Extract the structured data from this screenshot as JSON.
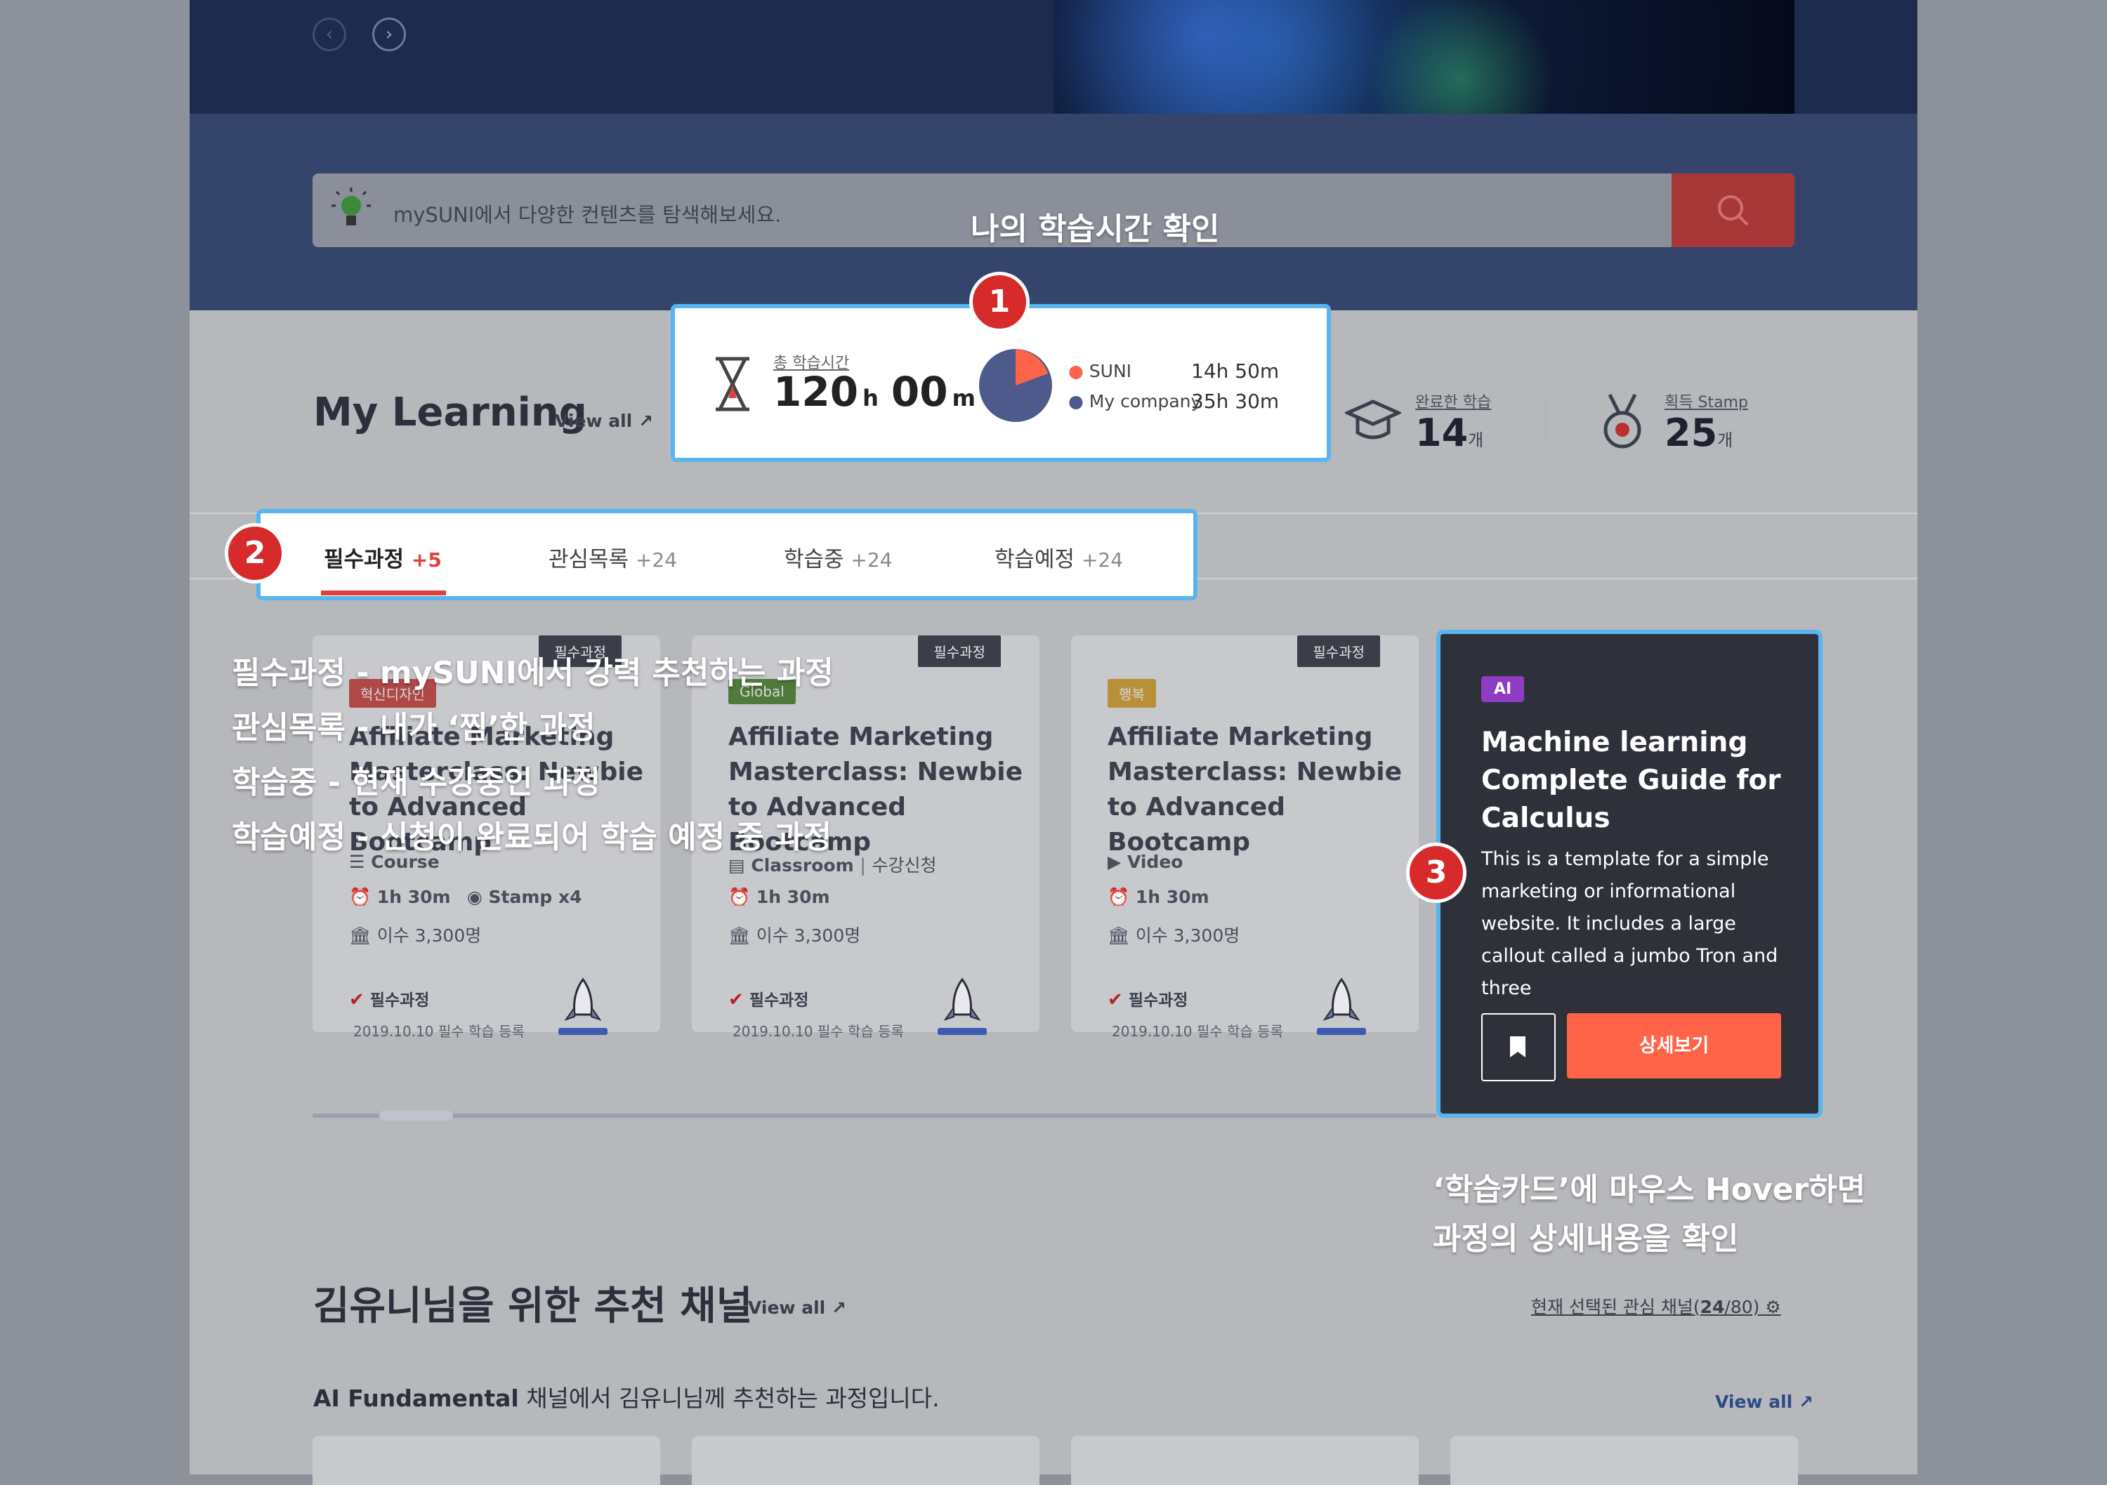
{
  "search": {
    "placeholder": "mySUNI에서 다양한 컨텐츠를 탐색해보세요."
  },
  "hero": {
    "prev_icon": "chevron-left-icon",
    "next_icon": "chevron-right-icon"
  },
  "my_learning": {
    "title": "My Learning",
    "view_all": "View all",
    "total_time": {
      "label": "총 학습시간",
      "hours": "120",
      "hours_unit": "h",
      "minutes": "00",
      "minutes_unit": "m",
      "breakdown": [
        {
          "name": "SUNI",
          "time": "14h 50m",
          "color": "#ff6348"
        },
        {
          "name": "My company",
          "time": "35h 30m",
          "color": "#4e5a8c"
        }
      ]
    },
    "completed": {
      "label": "완료한 학습",
      "value": "14",
      "unit": "개"
    },
    "stamp": {
      "label": "획득 Stamp",
      "value": "25",
      "unit": "개"
    }
  },
  "tabs": [
    {
      "label": "필수과정",
      "count": "+5",
      "active": true
    },
    {
      "label": "관심목록",
      "count": "+24"
    },
    {
      "label": "학습중",
      "count": "+24"
    },
    {
      "label": "학습예정",
      "count": "+24"
    }
  ],
  "cards": [
    {
      "tag": "필수과정",
      "chip": "혁신디자인",
      "chip_color": "#b04848",
      "title": "Affiliate Marketing Masterclass: Newbie to Advanced Bootcamp",
      "type": "Course",
      "duration": "1h 30m",
      "stamp": "Stamp x4",
      "students": "이수 3,300명",
      "required": "필수과정",
      "date": "2019.10.10 필수 학습 등록"
    },
    {
      "tag": "필수과정",
      "chip": "Global",
      "chip_color": "#4f7a3a",
      "title": "Affiliate Marketing Masterclass: Newbie to Advanced Bootcamp",
      "type": "Classroom",
      "type_extra": "수강신청",
      "duration": "1h 30m",
      "students": "이수 3,300명",
      "required": "필수과정",
      "date": "2019.10.10 필수 학습 등록"
    },
    {
      "tag": "필수과정",
      "chip": "행복",
      "chip_color": "#b8903a",
      "title": "Affiliate Marketing Masterclass: Newbie to Advanced Bootcamp",
      "type": "Video",
      "duration": "1h 30m",
      "students": "이수 3,300명",
      "required": "필수과정",
      "date": "2019.10.10 필수 학습 등록"
    }
  ],
  "hover_card": {
    "chip": "AI",
    "title": "Machine learning Complete Guide for Calculus",
    "description": "This is a template for a simple marketing or informational website. It includes a large callout called a jumbo Tron and three",
    "bookmark_icon": "bookmark-icon",
    "detail_button": "상세보기"
  },
  "annotations": {
    "badge1": "1",
    "badge2": "2",
    "badge3": "3",
    "time_note": "나의 학습시간 확인",
    "tab_notes": [
      "필수과정  - mySUNI에서 강력 추천하는 과정",
      "관심목록 - 내가 ‘찜’한 과정",
      "학습중 - 현재 수강중인 과정",
      "학습예정 - 신청이 완료되어 학습 예정 중 과정"
    ],
    "hover_note_1": "‘학습카드’에 마우스 Hover하면",
    "hover_note_2": "과정의 상세내용을 확인"
  },
  "recommend": {
    "title": "김유니님을 위한 추천 채널",
    "view_all": "View all",
    "selected_channels_prefix": "현재 선택된 관심 채널(",
    "selected_channels_value": "24",
    "selected_channels_suffix": "/80)",
    "channel_name": "AI Fundamental",
    "subtitle_rest": " 채널에서 김유니님께 추천하는 과정입니다.",
    "view_all_2": "View all"
  }
}
